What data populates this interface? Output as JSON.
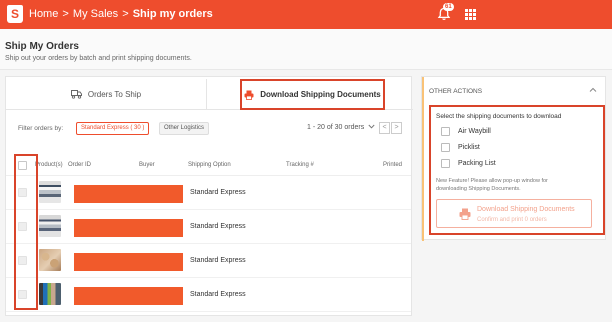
{
  "colors": {
    "brand": "#ee4d2d",
    "highlight_border": "#d9442a",
    "redaction": "#f15a2b"
  },
  "topbar": {
    "logo_glyph": "S",
    "breadcrumb": [
      "Home",
      "My Sales",
      "Ship my orders"
    ],
    "separator": ">",
    "notification_count": "61",
    "icons": [
      "bell-icon",
      "apps-grid-icon"
    ]
  },
  "header": {
    "title": "Ship My Orders",
    "subtitle": "Ship out your orders by batch and print shipping documents."
  },
  "tabs": {
    "orders_to_ship": "Orders To Ship",
    "download_docs": "Download Shipping Documents"
  },
  "filters": {
    "label": "Filter orders by:",
    "active_chip": "Standard Express ( 30 )",
    "other_chip": "Other Logistics",
    "pagination_text": "1 - 20 of 30 orders",
    "prev": "<",
    "next": ">"
  },
  "table": {
    "columns": {
      "product": "Product(s)",
      "order_id": "Order ID",
      "buyer": "Buyer",
      "shipping_option": "Shipping Option",
      "tracking": "Tracking #",
      "printed": "Printed"
    },
    "rows": [
      {
        "shipping_option": "Standard Express"
      },
      {
        "shipping_option": "Standard Express"
      },
      {
        "shipping_option": "Standard Express"
      },
      {
        "shipping_option": "Standard Express"
      }
    ]
  },
  "side_panel": {
    "title": "OTHER ACTIONS",
    "prompt": "Select the shipping documents to download",
    "options": [
      "Air Waybill",
      "Picklist",
      "Packing List"
    ],
    "note_line1": "New Feature! Please allow pop-up window for",
    "note_line2": "downloading Shipping Documents.",
    "button_label": "Download Shipping Documents",
    "button_sub": "Confirm and print 0 orders"
  }
}
